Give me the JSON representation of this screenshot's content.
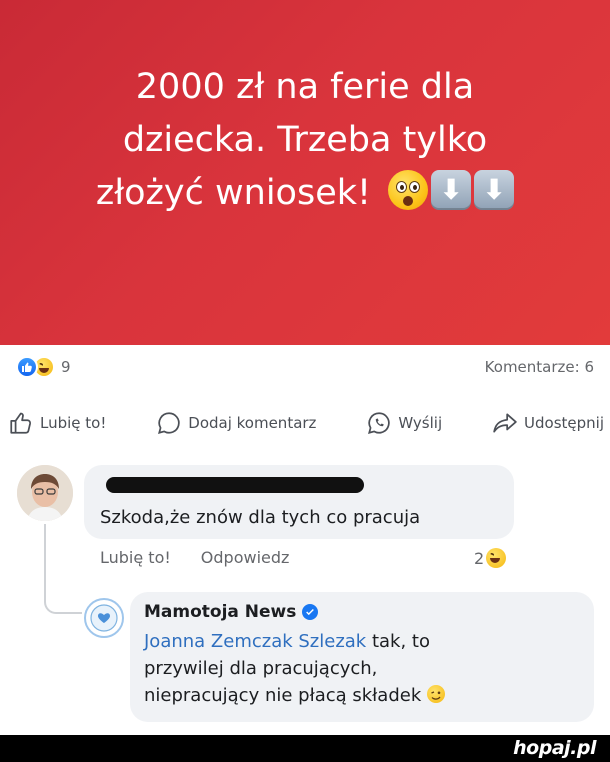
{
  "post": {
    "banner_line1": "2000 zł na ferie dla",
    "banner_line2": "dziecka. Trzeba tylko",
    "banner_line3": "złożyć wniosek!",
    "banner_emojis": [
      "astonished-face",
      "down-arrow-key",
      "down-arrow-key"
    ],
    "banner_color": "#d9343c"
  },
  "stats": {
    "reaction_count": "9",
    "comments_label": "Komentarze: 6"
  },
  "actions": {
    "like": "Lubię to!",
    "comment": "Dodaj komentarz",
    "send": "Wyślij",
    "share": "Udostępnij"
  },
  "comment1": {
    "text": "Szkoda,że znów dla tych co pracuja",
    "like": "Lubię to!",
    "reply": "Odpowiedz",
    "reaction_count": "2"
  },
  "reply1": {
    "author": "Mamotoja News",
    "mention": "Joanna Zemczak Szlezak",
    "text_line1": " tak, to",
    "text_line2": "przywilej dla pracujących,",
    "text_line3": "niepracujący nie płacą składek"
  },
  "footer": {
    "logo": "hopaj.pl"
  }
}
